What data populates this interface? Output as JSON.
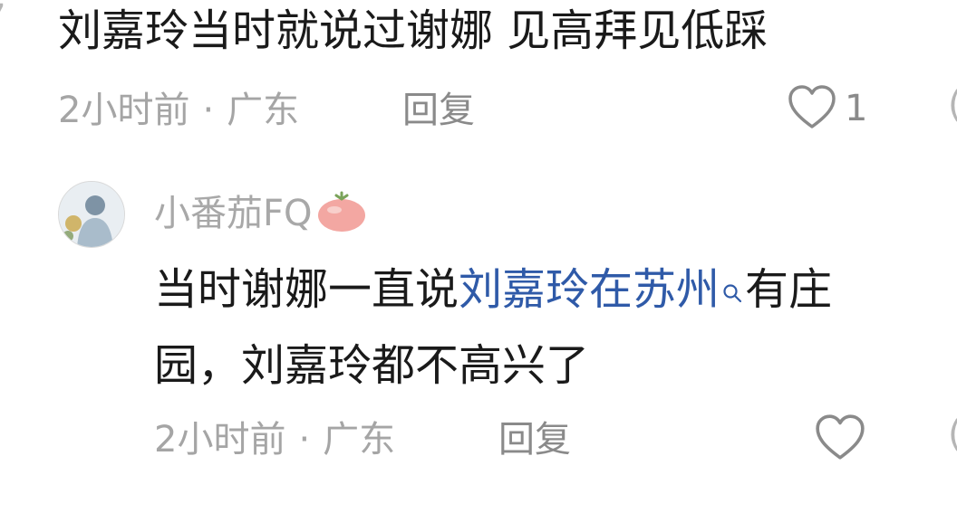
{
  "comments": [
    {
      "text": "刘嘉玲当时就说过谢娜  见高拜见低踩",
      "time": "2小时前",
      "location": "广东",
      "reply_label": "回复",
      "likes": "1"
    },
    {
      "username": "小番茄FQ",
      "text_before": "当时谢娜一直说",
      "link_text": "刘嘉玲在苏州",
      "text_after_line1": "有庄",
      "text_line2": "园，刘嘉玲都不高兴了",
      "time": "2小时前",
      "location": "广东",
      "reply_label": "回复"
    }
  ],
  "separator": "·",
  "colors": {
    "text": "#1a1a1a",
    "meta": "#a5a5a5",
    "link": "#2f5aa8",
    "icon": "#8a8a8a"
  },
  "icons": [
    "heart-icon",
    "search-icon",
    "tomato-icon",
    "avatar"
  ]
}
